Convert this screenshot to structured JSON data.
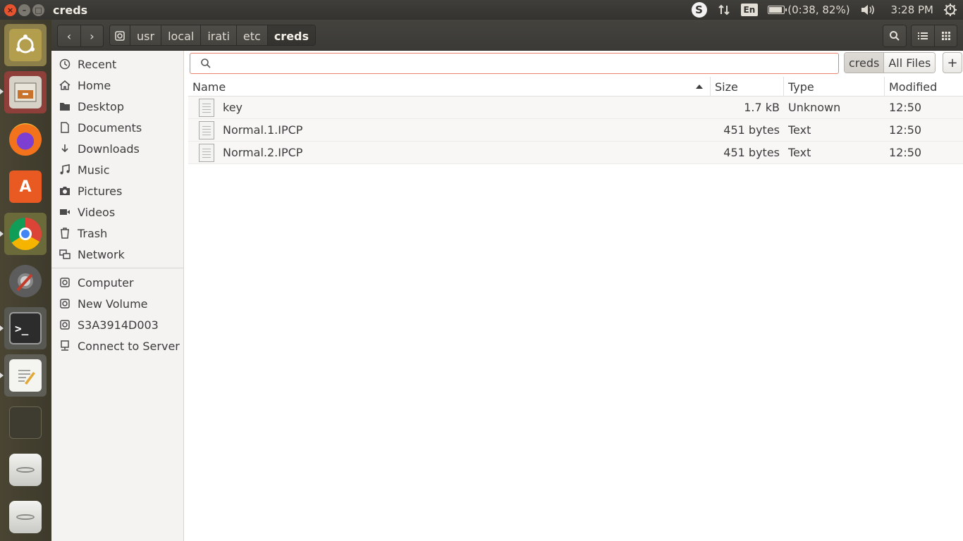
{
  "top_panel": {
    "window_title": "creds",
    "window_buttons": {
      "close": "×",
      "minimize": "–",
      "maximize": "□"
    },
    "indicators": {
      "skype_label": "S",
      "keyboard_layout": "En",
      "battery_text": "(0:38, 82%)",
      "battery_level": 0.82,
      "clock": "3:28 PM"
    }
  },
  "launcher": {
    "items": [
      {
        "name": "ubuntu-dash-icon"
      },
      {
        "name": "files-app-icon"
      },
      {
        "name": "firefox-icon"
      },
      {
        "name": "software-center-icon"
      },
      {
        "name": "chrome-icon"
      },
      {
        "name": "system-settings-icon"
      },
      {
        "name": "terminal-icon"
      },
      {
        "name": "text-editor-icon"
      },
      {
        "name": "workspace-switcher-icon"
      },
      {
        "name": "drive-icon"
      },
      {
        "name": "removable-drive-icon"
      }
    ]
  },
  "headerbar": {
    "back_glyph": "‹",
    "forward_glyph": "›",
    "path": [
      "usr",
      "local",
      "irati",
      "etc",
      "creds"
    ]
  },
  "sidebar": {
    "places": [
      {
        "label": "Recent",
        "icon": "clock-icon"
      },
      {
        "label": "Home",
        "icon": "home-icon"
      },
      {
        "label": "Desktop",
        "icon": "folder-icon"
      },
      {
        "label": "Documents",
        "icon": "document-icon"
      },
      {
        "label": "Downloads",
        "icon": "download-icon"
      },
      {
        "label": "Music",
        "icon": "music-icon"
      },
      {
        "label": "Pictures",
        "icon": "camera-icon"
      },
      {
        "label": "Videos",
        "icon": "video-icon"
      },
      {
        "label": "Trash",
        "icon": "trash-icon"
      },
      {
        "label": "Network",
        "icon": "network-icon"
      }
    ],
    "devices": [
      {
        "label": "Computer",
        "icon": "drive-icon"
      },
      {
        "label": "New Volume",
        "icon": "drive-icon"
      },
      {
        "label": "S3A3914D003",
        "icon": "drive-icon"
      },
      {
        "label": "Connect to Server",
        "icon": "server-icon"
      }
    ]
  },
  "search": {
    "value": "",
    "placeholder": "",
    "scopes": [
      "creds",
      "All Files"
    ],
    "active_scope": "creds",
    "add_label": "+"
  },
  "file_list": {
    "columns": [
      "Name",
      "Size",
      "Type",
      "Modified"
    ],
    "sort_column": "Name",
    "rows": [
      {
        "name": "key",
        "size": "1.7 kB",
        "type": "Unknown",
        "modified": "12:50"
      },
      {
        "name": "Normal.1.IPCP",
        "size": "451 bytes",
        "type": "Text",
        "modified": "12:50"
      },
      {
        "name": "Normal.2.IPCP",
        "size": "451 bytes",
        "type": "Text",
        "modified": "12:50"
      }
    ]
  }
}
